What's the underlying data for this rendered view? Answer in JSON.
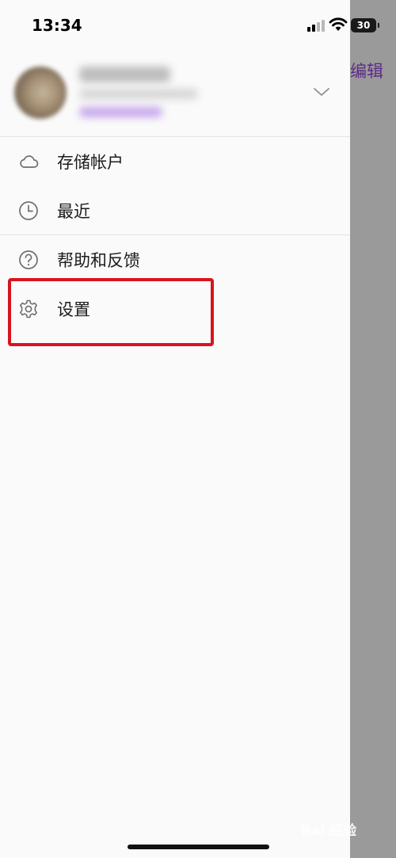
{
  "status_bar": {
    "time": "13:34",
    "battery": "30"
  },
  "backdrop": {
    "edit_label": "编辑"
  },
  "drawer": {
    "menu_items": [
      {
        "label": "存储帐户",
        "icon": "cloud-icon"
      },
      {
        "label": "最近",
        "icon": "clock-icon"
      },
      {
        "label": "帮助和反馈",
        "icon": "help-circle-icon"
      },
      {
        "label": "设置",
        "icon": "gear-icon"
      }
    ]
  },
  "watermark": "Bai 经验",
  "colors": {
    "highlight_border": "#d9141e",
    "edit_accent": "#5b2a86",
    "backdrop": "#9a9a9a"
  }
}
